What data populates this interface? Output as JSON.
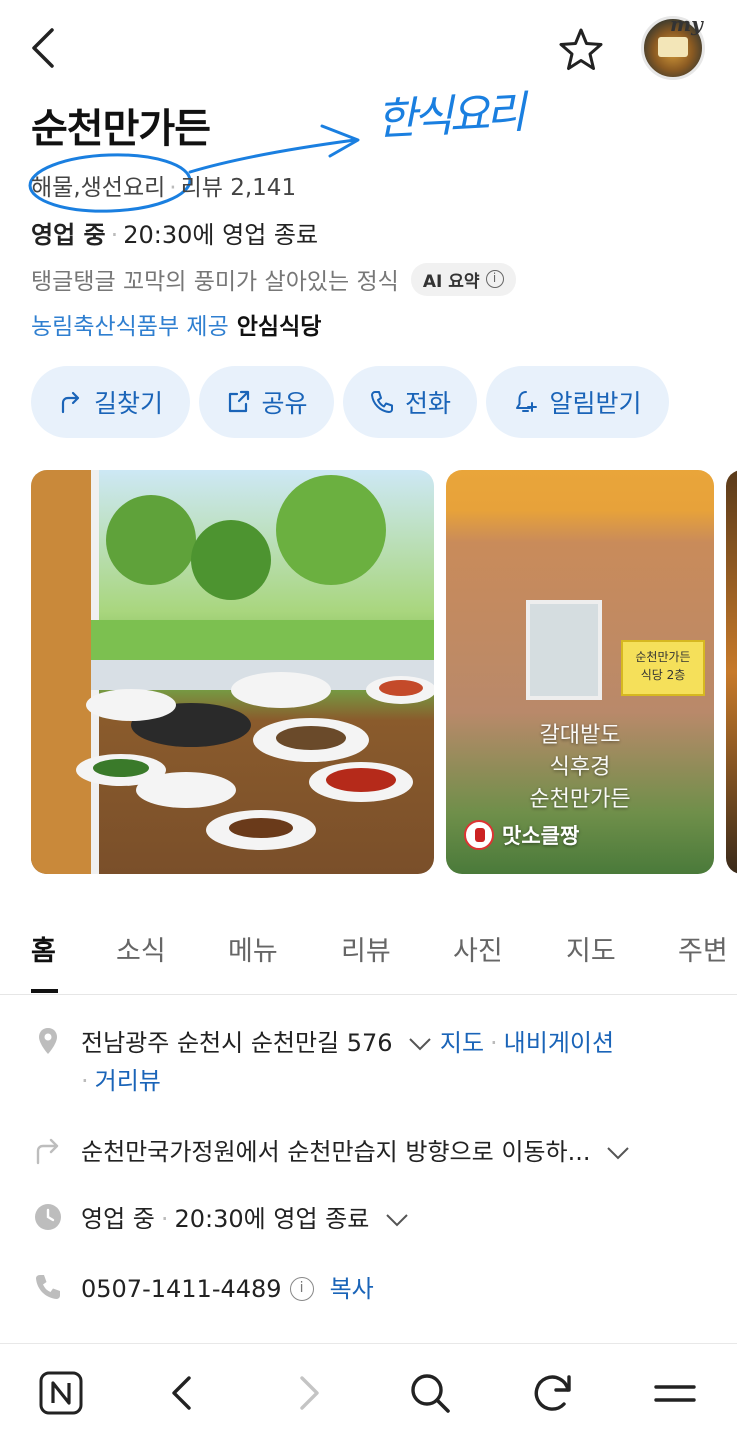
{
  "header": {
    "avatar_tag": "my",
    "title": "순천만가든",
    "annotation": "한식요리"
  },
  "meta": {
    "category": "해물,생선요리",
    "review_label": "리뷰",
    "review_count": "2,141"
  },
  "hours": {
    "status": "영업 중",
    "close_text": "20:30에 영업 종료"
  },
  "summary": {
    "text": "탱글탱글 꼬막의 풍미가 살아있는 정식",
    "ai_label": "AI 요약",
    "info_glyph": "i"
  },
  "provider": {
    "text": "농림축산식품부 제공",
    "badge": "안심식당"
  },
  "actions": [
    {
      "label": "길찾기",
      "icon": "directions-icon"
    },
    {
      "label": "공유",
      "icon": "share-icon"
    },
    {
      "label": "전화",
      "icon": "phone-icon"
    },
    {
      "label": "알림받기",
      "icon": "bell-plus-icon"
    }
  ],
  "gallery": {
    "photo2_caption_1": "갈대밭도",
    "photo2_caption_2": "식후경",
    "photo2_caption_3": "순천만가든",
    "photo2_user": "맛소클짱",
    "sign_text_1": "순천만가든",
    "sign_text_2": "식당 2층"
  },
  "tabs": [
    {
      "label": "홈",
      "active": true
    },
    {
      "label": "소식",
      "active": false
    },
    {
      "label": "메뉴",
      "active": false
    },
    {
      "label": "리뷰",
      "active": false
    },
    {
      "label": "사진",
      "active": false
    },
    {
      "label": "지도",
      "active": false
    },
    {
      "label": "주변",
      "active": false
    }
  ],
  "info": {
    "address": "전남광주 순천시 순천만길 576",
    "map_link": "지도",
    "navi_link": "내비게이션",
    "street_link": "거리뷰",
    "directions": "순천만국가정원에서 순천만습지 방향으로 이동하...",
    "hours_status": "영업 중",
    "hours_close": "20:30에 영업 종료",
    "phone": "0507-1411-4489",
    "copy_label": "복사",
    "phone_info_glyph": "i"
  },
  "colors": {
    "accent_blue": "#1a64b8",
    "chip_bg": "#e8f1fb",
    "provider_blue": "#2f7fd0",
    "annotation_blue": "#1a7fe0"
  },
  "bottom_bar": [
    "naver-home-icon",
    "back-icon",
    "forward-icon",
    "search-icon",
    "refresh-icon",
    "menu-icon"
  ]
}
